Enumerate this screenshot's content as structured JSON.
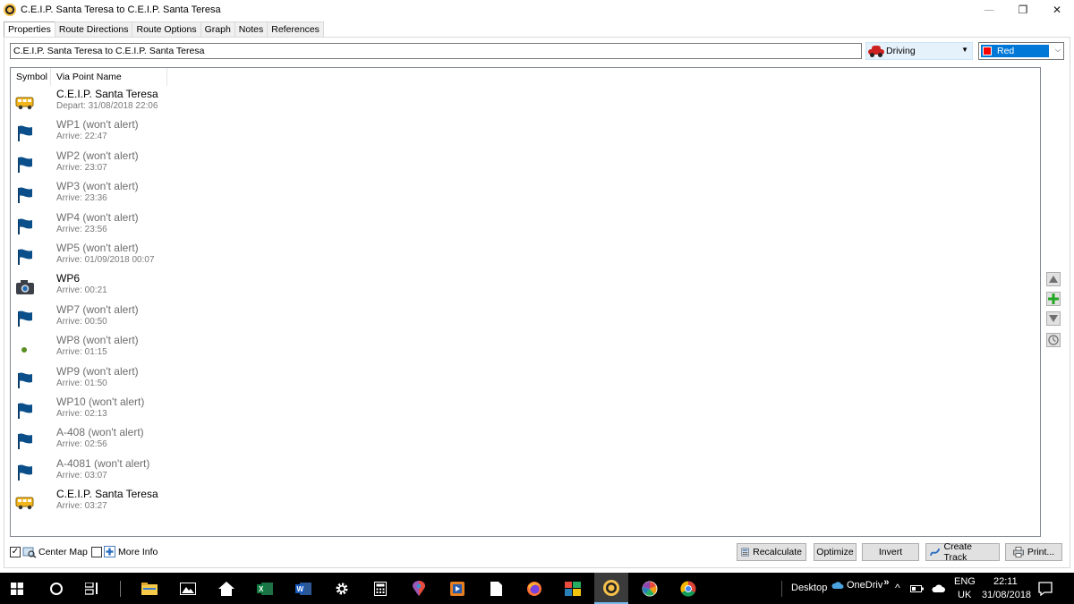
{
  "window": {
    "title": "C.E.I.P. Santa Teresa to C.E.I.P. Santa Teresa",
    "minimize_glyph": "—",
    "maximize_glyph": "❐",
    "close_glyph": "✕"
  },
  "tabs": [
    {
      "label": "Properties",
      "active": true
    },
    {
      "label": "Route Directions",
      "active": false
    },
    {
      "label": "Route Options",
      "active": false
    },
    {
      "label": "Graph",
      "active": false
    },
    {
      "label": "Notes",
      "active": false
    },
    {
      "label": "References",
      "active": false
    }
  ],
  "properties": {
    "route_name_value": "C.E.I.P. Santa Teresa to C.E.I.P. Santa Teresa",
    "mode_value": "Driving",
    "color_value": "Red",
    "color_swatch": "#ff0000"
  },
  "list": {
    "col_symbol": "Symbol",
    "col_name": "Via Point Name",
    "rows": [
      {
        "name": "C.E.I.P. Santa Teresa",
        "time": "Depart: 31/08/2018 22:06",
        "symbol": "school-bus-icon"
      },
      {
        "name": "WP1 (won't alert)",
        "time": "Arrive: 22:47",
        "symbol": "flag-icon"
      },
      {
        "name": "WP2 (won't alert)",
        "time": "Arrive: 23:07",
        "symbol": "flag-icon"
      },
      {
        "name": "WP3 (won't alert)",
        "time": "Arrive: 23:36",
        "symbol": "flag-icon"
      },
      {
        "name": "WP4 (won't alert)",
        "time": "Arrive: 23:56",
        "symbol": "flag-icon"
      },
      {
        "name": "WP5 (won't alert)",
        "time": "Arrive: 01/09/2018 00:07",
        "symbol": "flag-icon"
      },
      {
        "name": "WP6",
        "time": "Arrive: 00:21",
        "symbol": "camera-icon"
      },
      {
        "name": "WP7 (won't alert)",
        "time": "Arrive: 00:50",
        "symbol": "flag-icon"
      },
      {
        "name": "WP8 (won't alert)",
        "time": "Arrive: 01:15",
        "symbol": "green-dot-icon"
      },
      {
        "name": "WP9 (won't alert)",
        "time": "Arrive: 01:50",
        "symbol": "flag-icon"
      },
      {
        "name": "WP10 (won't alert)",
        "time": "Arrive: 02:13",
        "symbol": "flag-icon"
      },
      {
        "name": "A-408 (won't alert)",
        "time": "Arrive: 02:56",
        "symbol": "flag-icon"
      },
      {
        "name": "A-4081 (won't alert)",
        "time": "Arrive: 03:07",
        "symbol": "flag-icon"
      },
      {
        "name": "C.E.I.P. Santa Teresa",
        "time": "Arrive: 03:27",
        "symbol": "school-bus-icon"
      }
    ]
  },
  "options": {
    "center_map_label": "Center Map",
    "center_map_checked": true,
    "more_info_label": "More Info",
    "more_info_checked": false
  },
  "buttons": {
    "recalculate": "Recalculate",
    "optimize": "Optimize",
    "invert": "Invert",
    "create_track": "Create Track",
    "print": "Print..."
  },
  "taskbar": {
    "desktop_label": "Desktop",
    "onedrive_label": "OneDriv",
    "chevron": "»",
    "lang_top": "ENG",
    "lang_bottom": "UK",
    "time": "22:11",
    "date": "31/08/2018"
  },
  "colors": {
    "flag": "#0b4f8a",
    "selection": "#0078d7",
    "taskbar": "#000000"
  }
}
